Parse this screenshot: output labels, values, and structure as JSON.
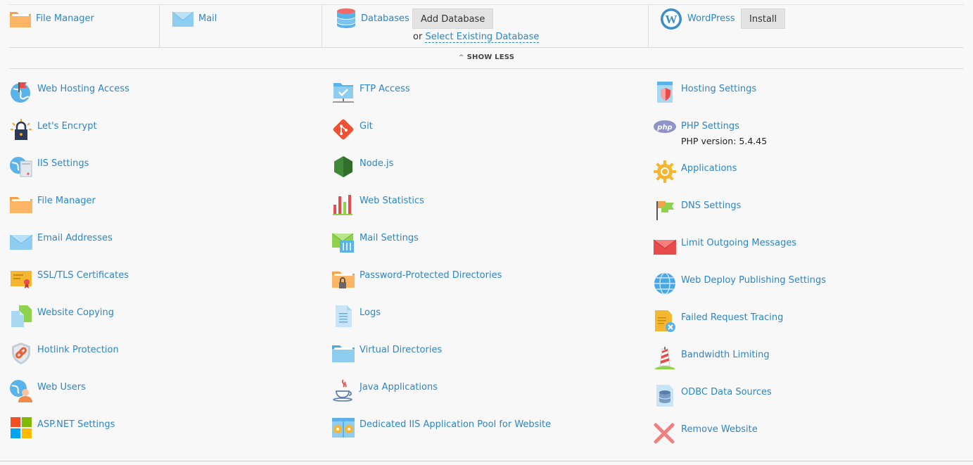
{
  "topbar": {
    "file_manager": "File Manager",
    "mail": "Mail",
    "databases": "Databases",
    "add_database": "Add Database",
    "or": "or",
    "select_existing": "Select Existing Database",
    "wordpress": "WordPress",
    "install": "Install"
  },
  "show_less": "SHOW LESS",
  "col1": [
    {
      "label": "Web Hosting Access",
      "icon": "globe-flag-icon"
    },
    {
      "label": "Let's Encrypt",
      "icon": "padlock-icon"
    },
    {
      "label": "IIS Settings",
      "icon": "globe-server-icon"
    },
    {
      "label": "File Manager",
      "icon": "folder-icon"
    },
    {
      "label": "Email Addresses",
      "icon": "envelope-icon"
    },
    {
      "label": "SSL/TLS Certificates",
      "icon": "certificate-icon"
    },
    {
      "label": "Website Copying",
      "icon": "copy-pages-icon"
    },
    {
      "label": "Hotlink Protection",
      "icon": "shield-link-icon"
    },
    {
      "label": "Web Users",
      "icon": "globe-user-icon"
    },
    {
      "label": "ASP.NET Settings",
      "icon": "windows-tiles-icon"
    }
  ],
  "col2": [
    {
      "label": "FTP Access",
      "icon": "ftp-folder-icon"
    },
    {
      "label": "Git",
      "icon": "git-icon"
    },
    {
      "label": "Node.js",
      "icon": "nodejs-hexagon-icon"
    },
    {
      "label": "Web Statistics",
      "icon": "bar-chart-icon"
    },
    {
      "label": "Mail Settings",
      "icon": "mail-sliders-icon"
    },
    {
      "label": "Password-Protected Directories",
      "icon": "locked-folder-icon"
    },
    {
      "label": "Logs",
      "icon": "log-document-icon"
    },
    {
      "label": "Virtual Directories",
      "icon": "blue-folder-icon"
    },
    {
      "label": "Java Applications",
      "icon": "java-cup-icon"
    },
    {
      "label": "Dedicated IIS Application Pool for Website",
      "icon": "app-pool-icon"
    }
  ],
  "col3": [
    {
      "label": "Hosting Settings",
      "icon": "document-shield-icon"
    },
    {
      "label": "PHP Settings",
      "icon": "php-icon",
      "subtext": "PHP version: 5.4.45"
    },
    {
      "label": "Applications",
      "icon": "gear-icon"
    },
    {
      "label": "DNS Settings",
      "icon": "dns-flags-icon"
    },
    {
      "label": "Limit Outgoing Messages",
      "icon": "red-envelope-icon"
    },
    {
      "label": "Web Deploy Publishing Settings",
      "icon": "blue-globe-icon"
    },
    {
      "label": "Failed Request Tracing",
      "icon": "error-document-icon"
    },
    {
      "label": "Bandwidth Limiting",
      "icon": "striped-pole-icon"
    },
    {
      "label": "ODBC Data Sources",
      "icon": "database-document-icon"
    },
    {
      "label": "Remove Website",
      "icon": "remove-x-icon"
    }
  ],
  "colors": {
    "link": "#2d86c5",
    "background": "#f8f8f8"
  }
}
